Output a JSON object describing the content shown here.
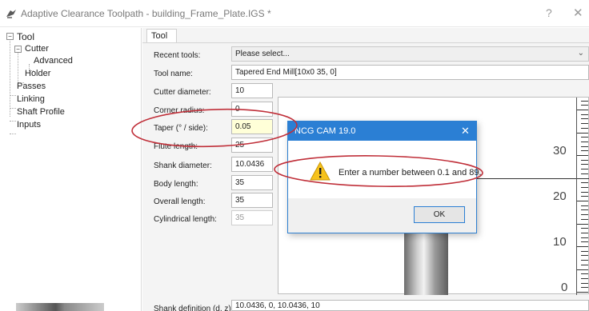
{
  "window": {
    "title": "Adaptive Clearance Toolpath - building_Frame_Plate.IGS *",
    "help_label": "?",
    "close_label": "✕"
  },
  "tree": {
    "items": [
      {
        "label": "Tool",
        "level": 0,
        "expanded": true
      },
      {
        "label": "Cutter",
        "level": 1,
        "expanded": true
      },
      {
        "label": "Advanced",
        "level": 2
      },
      {
        "label": "Holder",
        "level": 1
      },
      {
        "label": "Passes",
        "level": 0
      },
      {
        "label": "Linking",
        "level": 0
      },
      {
        "label": "Shaft Profile",
        "level": 0
      },
      {
        "label": "Inputs",
        "level": 0
      }
    ]
  },
  "tabs": [
    {
      "label": "Tool",
      "active": true
    }
  ],
  "form": {
    "recent_tools": {
      "label": "Recent tools:",
      "value": "Please select..."
    },
    "tool_name": {
      "label": "Tool name:",
      "value": "Tapered End Mill[10x0 35, 0]"
    },
    "cutter_diameter": {
      "label": "Cutter diameter:",
      "value": "10"
    },
    "corner_radius": {
      "label": "Corner radius:",
      "value": "0"
    },
    "taper": {
      "label": "Taper (° / side):",
      "value": "0.05"
    },
    "flute_length": {
      "label": "Flute length:",
      "value": "25"
    },
    "shank_diameter": {
      "label": "Shank diameter:",
      "value": "10.0436"
    },
    "body_length": {
      "label": "Body length:",
      "value": "35"
    },
    "overall_length": {
      "label": "Overall length:",
      "value": "35"
    },
    "cylindrical_length": {
      "label": "Cylindrical length:",
      "value": "35"
    },
    "shank_definition": {
      "label": "Shank definition (d, z):",
      "value": "10.0436, 0, 10.0436, 10"
    }
  },
  "preview": {
    "ruler_labels": [
      "30",
      "20",
      "10",
      "0"
    ]
  },
  "dialog": {
    "title": "NCG CAM 19.0",
    "close_label": "✕",
    "message": "Enter a number between 0.1 and 89.",
    "ok_label": "OK",
    "icon": "warning-icon"
  },
  "colors": {
    "dialog_title_bar": "#2b7fd4",
    "annotation": "#c0303a",
    "highlight_field": "#ffffd8"
  }
}
